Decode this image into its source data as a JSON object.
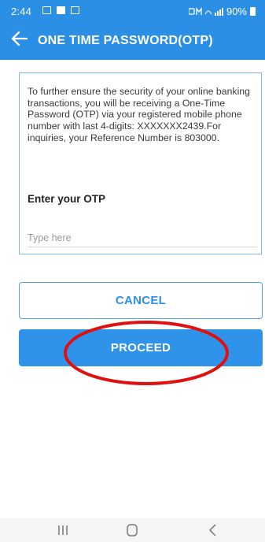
{
  "status_bar": {
    "time": "2:44",
    "battery": "90%"
  },
  "header": {
    "title": "ONE TIME PASSWORD(OTP)"
  },
  "otp_card": {
    "message": "To further ensure the security of your online banking transactions, you will be receiving a One-Time Password (OTP) via your registered mobile phone number with last 4-digits: XXXXXXX2439.For inquiries, your Reference Number is 803000.",
    "label": "Enter your OTP",
    "input_value": "",
    "input_placeholder": "Type here"
  },
  "buttons": {
    "cancel_label": "CANCEL",
    "proceed_label": "PROCEED"
  },
  "colors": {
    "brand_blue": "#2b8fe6",
    "annotation_red": "#e01010"
  },
  "icons": {
    "back": "arrow-left-icon",
    "nav_recent": "recent-apps-icon",
    "nav_home": "home-icon",
    "nav_back": "chevron-left-icon"
  }
}
